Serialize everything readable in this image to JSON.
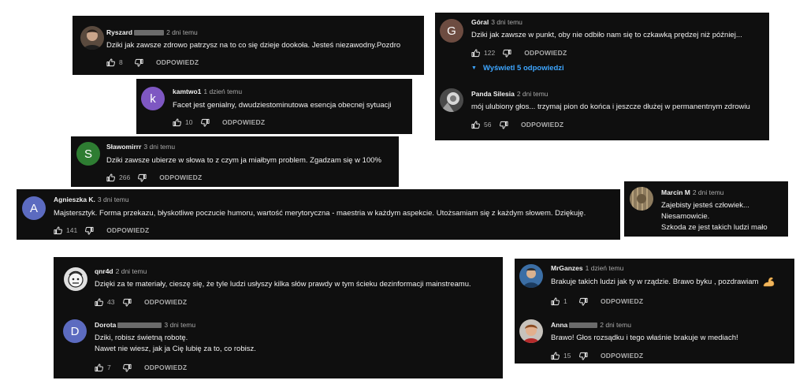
{
  "colors": {
    "card_bg": "#0f0f0f",
    "text": "#f1f1f1",
    "muted": "#aaaaaa",
    "link": "#3ea6ff"
  },
  "icons": {
    "like": "thumb-up-icon",
    "dislike": "thumb-down-icon",
    "expand": "caret-down-icon"
  },
  "reply_label": "ODPOWIEDZ",
  "comments": {
    "ryszard": {
      "author": "Ryszard",
      "time": "2 dni temu",
      "text": "Dziki jak zawsze zdrowo patrzysz na to co się dzieje dookoła. Jesteś niezawodny.Pozdro",
      "likes": "8"
    },
    "kamtwo": {
      "author": "kamtwo1",
      "time": "1 dzień temu",
      "avatar_letter": "k",
      "text": "Facet jest genialny, dwudziestominutowa esencja obecnej sytuacji",
      "likes": "10"
    },
    "slawomir": {
      "author": "Sławomirrr",
      "time": "3 dni temu",
      "avatar_letter": "S",
      "text": "Dziki zawsze ubierze w słowa to z czym ja miałbym problem. Zgadzam się w 100%",
      "likes": "266"
    },
    "agnieszka": {
      "author": "Agnieszka K.",
      "time": "3 dni temu",
      "avatar_letter": "A",
      "text": "Majstersztyk. Forma przekazu, błyskotliwe poczucie humoru, wartość merytoryczna - maestria w każdym aspekcie. Utożsamiam się z każdym słowem. Dziękuję.",
      "likes": "141"
    },
    "goral": {
      "author": "Góral",
      "time": "3 dni temu",
      "avatar_letter": "G",
      "text": "Dziki jak zawsze w punkt, oby nie odbiło nam się to czkawką prędzej niż później...",
      "likes": "122",
      "replies_label": "Wyświetl 5 odpowiedzi"
    },
    "panda": {
      "author": "Panda Silesia",
      "time": "2 dni temu",
      "text": "mój ulubiony głos... trzymaj pion do końca i jeszcze dłużej w permanentnym zdrowiu",
      "likes": "56"
    },
    "marcin": {
      "author": "Marcin M",
      "time": "2 dni temu",
      "line1": "Zajebisty jesteś człowiek...",
      "line2": "Niesamowicie.",
      "line3": "Szkoda ze jest takich ludzi mało"
    },
    "qnr4d": {
      "author": "qnr4d",
      "time": "2 dni temu",
      "text": "Dzięki za te materiały, cieszę się, że tyle ludzi usłyszy kilka słów prawdy w tym ścieku dezinformacji mainstreamu.",
      "likes": "43"
    },
    "dorota": {
      "author": "Dorota",
      "time": "3 dni temu",
      "avatar_letter": "D",
      "line1": "Dziki, robisz świetną robotę.",
      "line2": "Nawet nie wiesz, jak ja Cię lubię za to, co robisz.",
      "likes": "7"
    },
    "mrganzes": {
      "author": "MrGanzes",
      "time": "1 dzień temu",
      "text": "Brakuje takich ludzi jak ty w rządzie. Brawo byku , pozdrawiam",
      "emoji_icon": "flexed-biceps-icon",
      "likes": "1"
    },
    "anna": {
      "author": "Anna",
      "time": "2 dni temu",
      "text": "Brawo! Głos rozsądku i tego właśnie brakuje w mediach!",
      "likes": "15"
    }
  }
}
